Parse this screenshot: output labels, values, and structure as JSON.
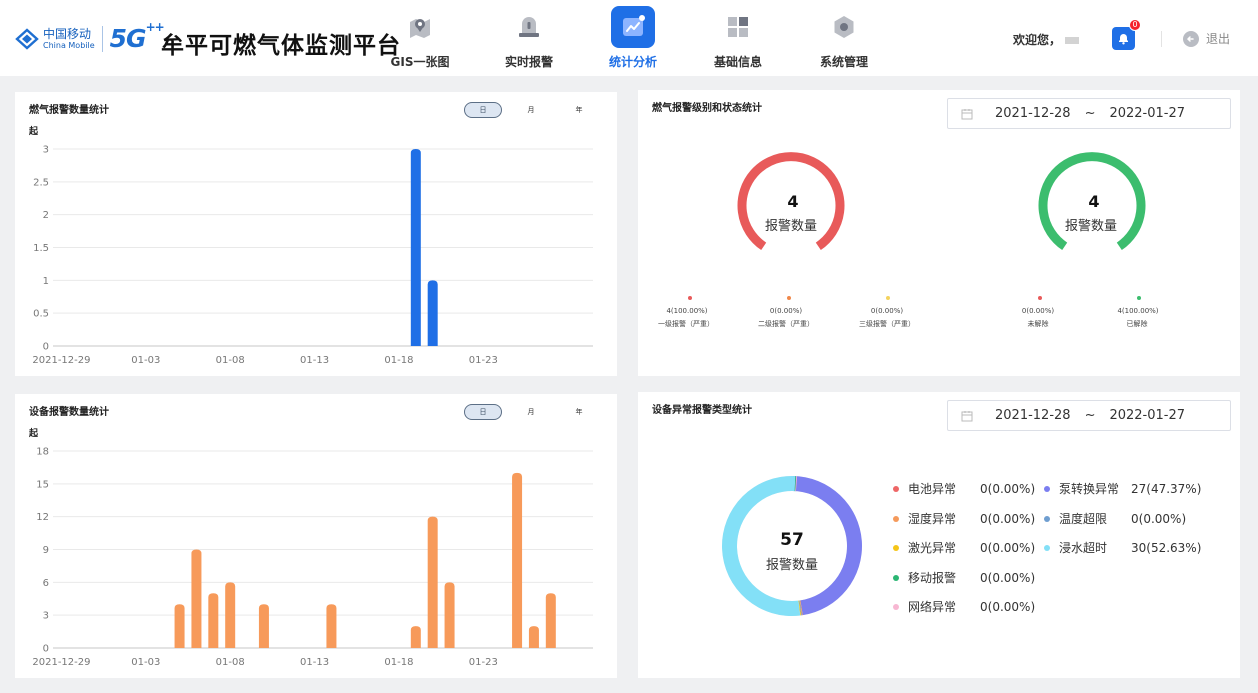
{
  "header": {
    "brand_cn": "中国移动",
    "brand_en": "China Mobile",
    "fiveg": "5G",
    "fiveg_plus": "++",
    "app_title": "牟平可燃气体监测平台",
    "welcome": "欢迎您，",
    "notification_count": "0",
    "logout": "退出"
  },
  "nav": [
    {
      "label": "GIS一张图",
      "icon": "map-pin-icon",
      "active": false
    },
    {
      "label": "实时报警",
      "icon": "alarm-icon",
      "active": false
    },
    {
      "label": "统计分析",
      "icon": "chart-icon",
      "active": true
    },
    {
      "label": "基础信息",
      "icon": "grid-icon",
      "active": false
    },
    {
      "label": "系统管理",
      "icon": "settings-icon",
      "active": false
    }
  ],
  "gas_alarm_chart": {
    "title": "燃气报警数量统计",
    "periods": [
      "日",
      "月",
      "年"
    ],
    "active_period": "日"
  },
  "device_alarm_chart": {
    "title": "设备报警数量统计",
    "periods": [
      "日",
      "月",
      "年"
    ],
    "active_period": "日"
  },
  "level_status": {
    "title": "燃气报警级别和状态统计",
    "date_start": "2021-12-28",
    "date_sep": "~",
    "date_end": "2022-01-27",
    "level_gauge": {
      "value": "4",
      "label": "报警数量"
    },
    "status_gauge": {
      "value": "4",
      "label": "报警数量"
    },
    "level_legend": [
      {
        "value": "4(100.00%)",
        "name": "一级报警（严重）",
        "color": "#e85a5a"
      },
      {
        "value": "0(0.00%)",
        "name": "二级报警（严重）",
        "color": "#f0884a"
      },
      {
        "value": "0(0.00%)",
        "name": "三级报警（严重）",
        "color": "#f4d35e"
      }
    ],
    "status_legend": [
      {
        "value": "0(0.00%)",
        "name": "未解除",
        "color": "#e85a5a"
      },
      {
        "value": "4(100.00%)",
        "name": "已解除",
        "color": "#3cbd6e"
      }
    ]
  },
  "device_type": {
    "title": "设备异常报警类型统计",
    "date_start": "2021-12-28",
    "date_sep": "~",
    "date_end": "2022-01-27",
    "total": "57",
    "total_label": "报警数量",
    "legend": [
      {
        "name": "电池异常",
        "value": "0(0.00%)",
        "color": "#ee6666"
      },
      {
        "name": "泵转换异常",
        "value": "27(47.37%)",
        "color": "#7b7ef0"
      },
      {
        "name": "湿度异常",
        "value": "0(0.00%)",
        "color": "#f59a5b"
      },
      {
        "name": "温度超限",
        "value": "0(0.00%)",
        "color": "#6f9ed0"
      },
      {
        "name": "激光异常",
        "value": "0(0.00%)",
        "color": "#f5c518"
      },
      {
        "name": "浸水超时",
        "value": "30(52.63%)",
        "color": "#83e0f7"
      },
      {
        "name": "移动报警",
        "value": "0(0.00%)",
        "color": "#2bb673"
      },
      {
        "name": "网络异常",
        "value": "0(0.00%)",
        "color": "#f7b7d2"
      }
    ]
  },
  "chart_data": [
    {
      "type": "bar",
      "title": "燃气报警数量统计",
      "ylabel": "起",
      "ylim": [
        0,
        3
      ],
      "yticks": [
        "0",
        "0.5",
        "1",
        "1.5",
        "2",
        "2.5",
        "3"
      ],
      "xticks": [
        "2021-12-29",
        "01-03",
        "01-08",
        "01-13",
        "01-18",
        "01-23"
      ],
      "x": [
        "12-29",
        "12-30",
        "12-31",
        "01-01",
        "01-02",
        "01-03",
        "01-04",
        "01-05",
        "01-06",
        "01-07",
        "01-08",
        "01-09",
        "01-10",
        "01-11",
        "01-12",
        "01-13",
        "01-14",
        "01-15",
        "01-16",
        "01-17",
        "01-18",
        "01-19",
        "01-20",
        "01-21",
        "01-22",
        "01-23",
        "01-24",
        "01-25",
        "01-26",
        "01-27",
        "01-28",
        "01-29"
      ],
      "values": [
        0,
        0,
        0,
        0,
        0,
        0,
        0,
        0,
        0,
        0,
        0,
        0,
        0,
        0,
        0,
        0,
        0,
        0,
        0,
        0,
        0,
        3,
        1,
        0,
        0,
        0,
        0,
        0,
        0,
        0,
        0,
        0
      ],
      "color": "#1f6fe6",
      "grid": true
    },
    {
      "type": "bar",
      "title": "设备报警数量统计",
      "ylabel": "起",
      "ylim": [
        0,
        18
      ],
      "yticks": [
        "0",
        "3",
        "6",
        "9",
        "12",
        "15",
        "18"
      ],
      "xticks": [
        "2021-12-29",
        "01-03",
        "01-08",
        "01-13",
        "01-18",
        "01-23"
      ],
      "x": [
        "12-29",
        "12-30",
        "12-31",
        "01-01",
        "01-02",
        "01-03",
        "01-04",
        "01-05",
        "01-06",
        "01-07",
        "01-08",
        "01-09",
        "01-10",
        "01-11",
        "01-12",
        "01-13",
        "01-14",
        "01-15",
        "01-16",
        "01-17",
        "01-18",
        "01-19",
        "01-20",
        "01-21",
        "01-22",
        "01-23",
        "01-24",
        "01-25",
        "01-26",
        "01-27",
        "01-28",
        "01-29"
      ],
      "values": [
        0,
        0,
        0,
        0,
        0,
        0,
        0,
        4,
        9,
        5,
        6,
        0,
        4,
        0,
        0,
        0,
        4,
        0,
        0,
        0,
        0,
        2,
        12,
        6,
        0,
        0,
        0,
        16,
        2,
        5,
        0,
        0
      ],
      "color": "#f79a5a",
      "grid": true
    },
    {
      "type": "pie",
      "title": "设备异常报警类型统计",
      "categories": [
        "电池异常",
        "泵转换异常",
        "湿度异常",
        "温度超限",
        "激光异常",
        "浸水超时",
        "移动报警",
        "网络异常"
      ],
      "values": [
        0,
        27,
        0,
        0,
        0,
        30,
        0,
        0
      ],
      "colors": [
        "#ee6666",
        "#7b7ef0",
        "#f59a5b",
        "#6f9ed0",
        "#f5c518",
        "#83e0f7",
        "#2bb673",
        "#f7b7d2"
      ]
    }
  ]
}
